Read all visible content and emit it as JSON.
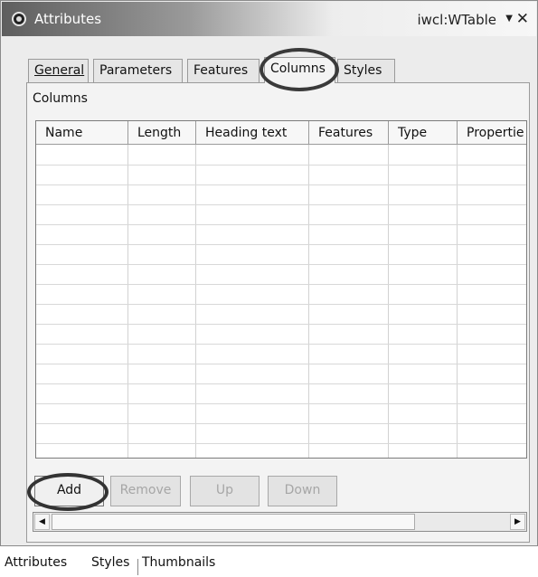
{
  "window": {
    "title": "Attributes",
    "selection": "iwcl:WTable",
    "menu_glyph": "▼",
    "close_glyph": "✕"
  },
  "tabs": [
    {
      "label": "General"
    },
    {
      "label": "Parameters"
    },
    {
      "label": "Features"
    },
    {
      "label": "Columns"
    },
    {
      "label": "Styles"
    }
  ],
  "active_tab": "Columns",
  "section": {
    "label": "Columns"
  },
  "table": {
    "columns": [
      "Name",
      "Length",
      "Heading text",
      "Features",
      "Type",
      "Propertie"
    ],
    "rows": []
  },
  "buttons": {
    "add": "Add",
    "remove": "Remove",
    "up": "Up",
    "down": "Down"
  },
  "scrollbar": {
    "left_glyph": "◀",
    "right_glyph": "▶"
  },
  "bottom_tabs": [
    {
      "label": "Attributes"
    },
    {
      "label": "Styles"
    },
    {
      "label": "Thumbnails"
    }
  ]
}
